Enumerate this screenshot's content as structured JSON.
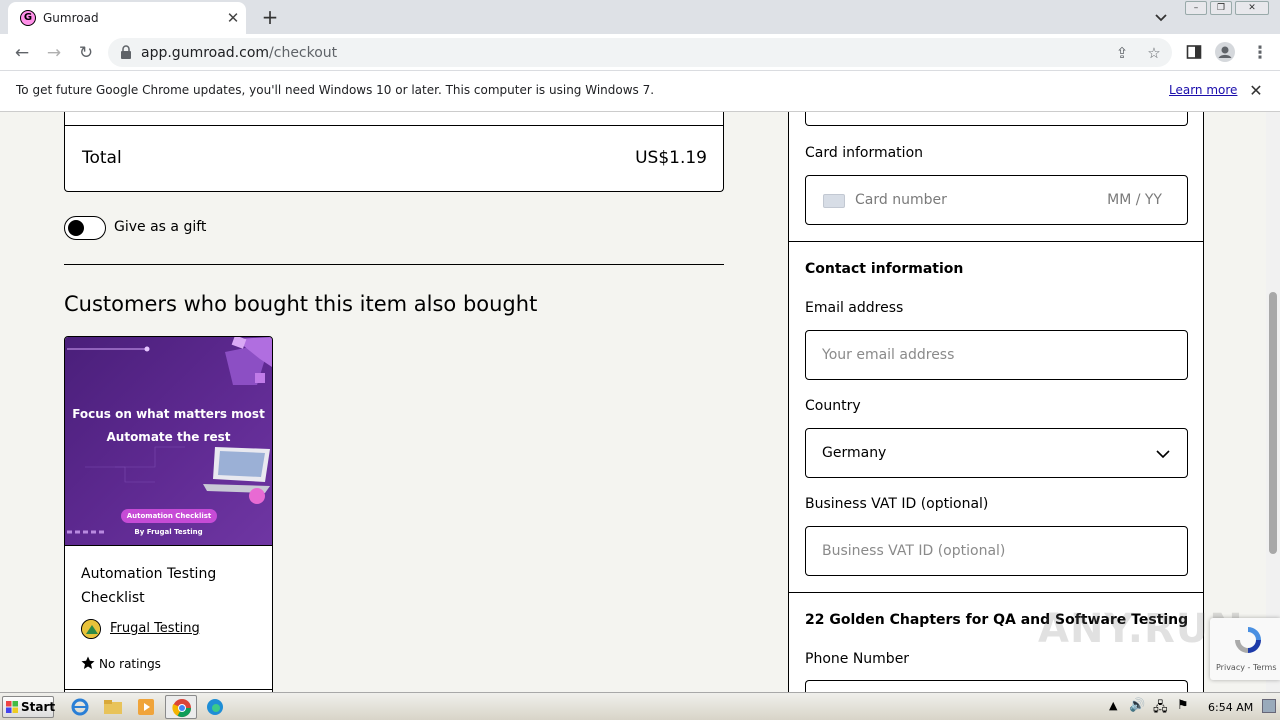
{
  "browser": {
    "tab_title": "Gumroad",
    "tab_favicon_letter": "G",
    "url_host": "app.gumroad.com",
    "url_path": "/checkout",
    "infobar_text": "To get future Google Chrome updates, you'll need Windows 10 or later. This computer is using Windows 7.",
    "infobar_link": "Learn more"
  },
  "summary": {
    "total_label": "Total",
    "total_value": "US$1.19"
  },
  "gift": {
    "label": "Give as a gift",
    "enabled": false
  },
  "recommendations": {
    "heading": "Customers who bought this item also bought",
    "product": {
      "thumb_line1": "Focus on what matters most",
      "thumb_line2": "Automate the rest",
      "thumb_badge": "Automation Checklist",
      "thumb_by": "By Frugal Testing",
      "title": "Automation Testing Checklist",
      "creator": "Frugal Testing",
      "ratings": "No ratings"
    }
  },
  "payment": {
    "card_info_label": "Card information",
    "card_number_placeholder": "Card number",
    "expiry_placeholder": "MM / YY"
  },
  "contact": {
    "heading": "Contact information",
    "email_label": "Email address",
    "email_placeholder": "Your email address",
    "country_label": "Country",
    "country_value": "Germany",
    "vat_label": "Business VAT ID (optional)",
    "vat_placeholder": "Business VAT ID (optional)"
  },
  "product_fields": {
    "heading": "22 Golden Chapters for QA and Software Testing",
    "phone_label": "Phone Number"
  },
  "recaptcha": {
    "text": "Privacy - Terms"
  },
  "watermark": "ANY.RUN",
  "taskbar": {
    "start_label": "Start",
    "clock": "6:54 AM"
  },
  "colors": {
    "page_bg": "#f4f4f0",
    "thumb_purple": "#5f2a92",
    "badge_pink": "#c64bd6"
  }
}
